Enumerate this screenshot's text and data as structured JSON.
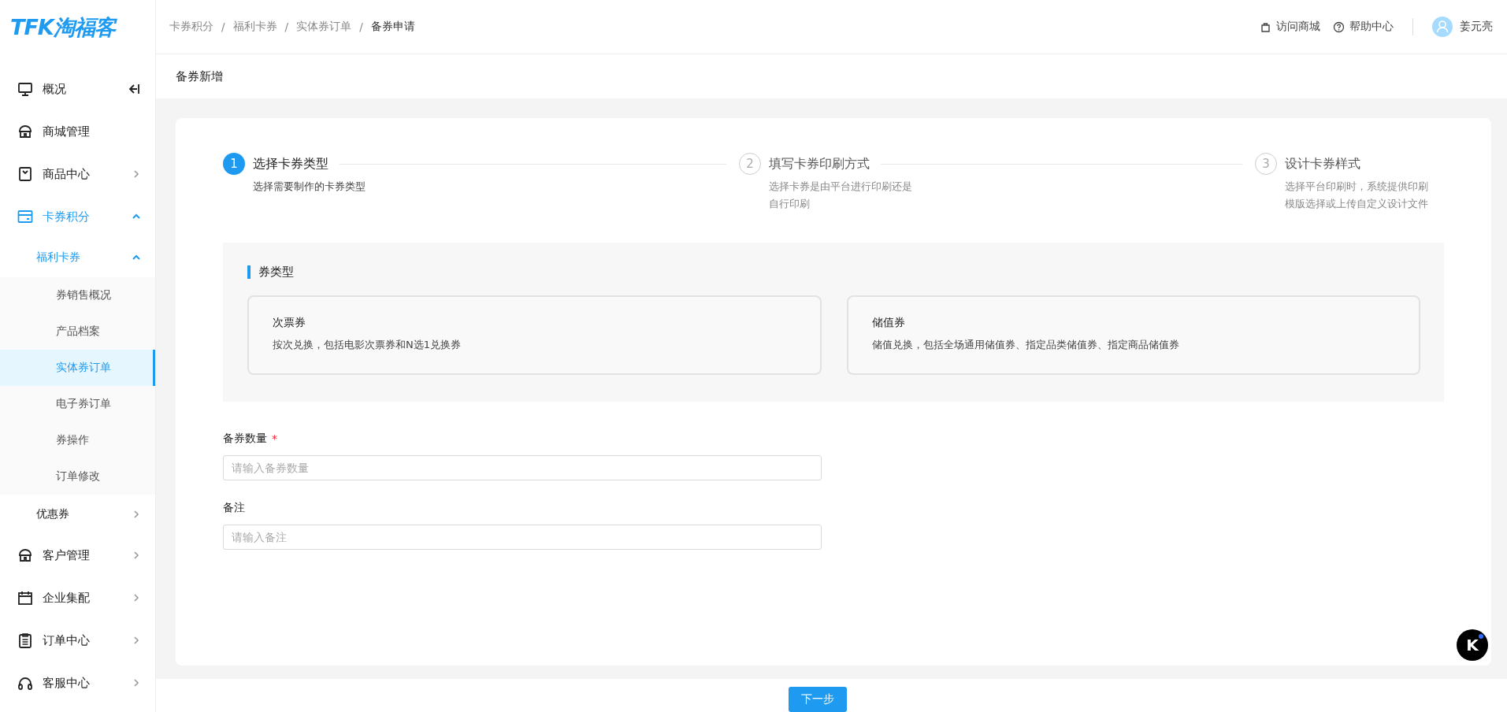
{
  "logo": "TFK淘福客",
  "breadcrumb": {
    "separator": "/",
    "items": [
      {
        "label": "卡券积分",
        "current": false
      },
      {
        "label": "福利卡券",
        "current": false
      },
      {
        "label": "实体券订单",
        "current": false
      },
      {
        "label": "备券申请",
        "current": true
      }
    ]
  },
  "header_links": [
    {
      "label": "访问商城"
    },
    {
      "label": "帮助中心"
    }
  ],
  "user": {
    "name": "姜元亮"
  },
  "sidebar": {
    "items": [
      {
        "label": "概况",
        "kind": "leaf",
        "selected": false
      },
      {
        "label": "商城管理",
        "kind": "leaf",
        "selected": false
      },
      {
        "label": "商品中心",
        "kind": "group",
        "expanded": false
      },
      {
        "label": "卡券积分",
        "kind": "group",
        "expanded": true,
        "children": [
          {
            "label": "福利卡券",
            "kind": "group",
            "expanded": true,
            "children": [
              {
                "label": "券销售概况",
                "kind": "leaf",
                "selected": false
              },
              {
                "label": "产品档案",
                "kind": "leaf",
                "selected": false
              },
              {
                "label": "实体券订单",
                "kind": "leaf",
                "selected": true
              },
              {
                "label": "电子券订单",
                "kind": "leaf",
                "selected": false
              },
              {
                "label": "券操作",
                "kind": "leaf",
                "selected": false
              },
              {
                "label": "订单修改",
                "kind": "leaf",
                "selected": false
              }
            ]
          },
          {
            "label": "优惠券",
            "kind": "group",
            "expanded": false
          }
        ]
      },
      {
        "label": "客户管理",
        "kind": "group",
        "expanded": false
      },
      {
        "label": "企业集配",
        "kind": "group",
        "expanded": false
      },
      {
        "label": "订单中心",
        "kind": "group",
        "expanded": false
      },
      {
        "label": "客服中心",
        "kind": "group",
        "expanded": false
      }
    ]
  },
  "page_title": "备券新增",
  "steps": [
    {
      "number": "1",
      "title": "选择卡券类型",
      "description": "选择需要制作的卡券类型",
      "active": true
    },
    {
      "number": "2",
      "title": "填写卡券印刷方式",
      "description": "选择卡券是由平台进行印刷还是自行印刷",
      "active": false
    },
    {
      "number": "3",
      "title": "设计卡券样式",
      "description": "选择平台印刷时，系统提供印刷模版选择或上传自定义设计文件",
      "active": false
    }
  ],
  "coupon_type": {
    "title": "券类型",
    "options": [
      {
        "title": "次票券",
        "description": "按次兑换，包括电影次票券和N选1兑换券",
        "selected": false
      },
      {
        "title": "储值券",
        "description": "储值兑换，包括全场通用储值券、指定品类储值券、指定商品储值券",
        "selected": false
      }
    ]
  },
  "fields": [
    {
      "label": "备券数量",
      "required_mark": "*",
      "placeholder": "请输入备券数量"
    },
    {
      "label": "备注",
      "placeholder": "请输入备注"
    }
  ],
  "next_button": "下一步",
  "assistant_button": {
    "label": "K"
  }
}
